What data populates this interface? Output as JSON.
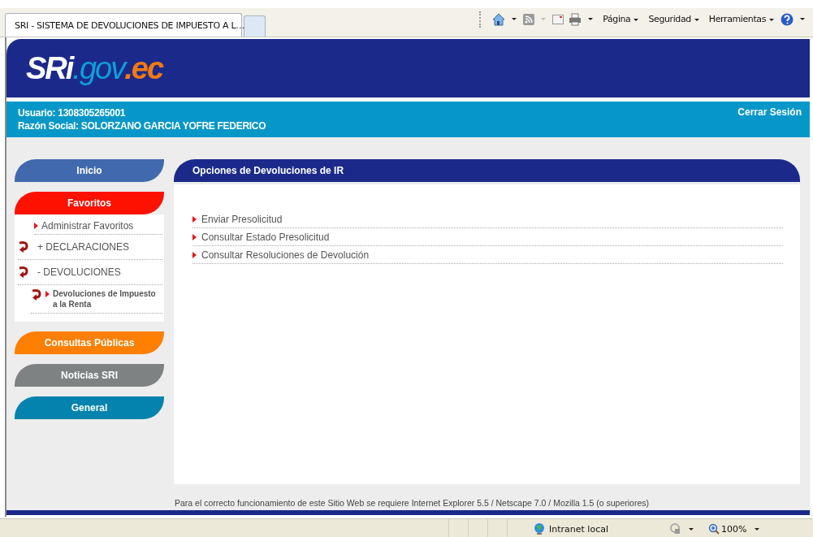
{
  "browser": {
    "tabs": [
      {
        "title": "SRI - SISTEMA DE DEVOLUCIONES DE IMPUESTO A L…",
        "selected": true
      },
      {
        "selected": false
      }
    ],
    "toolbar": [
      "Página",
      "Seguridad",
      "Herramientas"
    ]
  },
  "header": {
    "logo": [
      "SRi",
      ".gov",
      ".ec"
    ]
  },
  "user_bar": {
    "lines": [
      "Usuario: 1308305265001",
      "Razón Social: SOLORZANO GARCIA YOFRE FEDERICO"
    ],
    "logout": "Cerrar Sesión"
  },
  "sidebar": {
    "items": [
      {
        "label": "Inicio",
        "color": "#4169ae"
      },
      {
        "label": "Favoritos",
        "color": "#ff1100",
        "children": [
          {
            "kind": "link",
            "label": "Administrar Favoritos"
          },
          {
            "kind": "folder",
            "label": "+ DECLARACIONES"
          },
          {
            "kind": "folder",
            "label": "- DEVOLUCIONES",
            "children": [
              {
                "kind": "sublink",
                "label": "Devoluciones de Impuesto a la Renta"
              }
            ]
          }
        ]
      },
      {
        "label": "Consultas Públicas",
        "color": "#ff7f00"
      },
      {
        "label": "Noticias SRI",
        "color": "#7f8283"
      },
      {
        "label": "General",
        "color": "#0383ad"
      }
    ]
  },
  "content": {
    "title": "Opciones de Devoluciones de IR",
    "links": [
      "Enviar Presolicitud",
      "Consultar Estado Presolicitud",
      "Consultar Resoluciones de Devolución"
    ]
  },
  "footer": "Para el correcto funcionamiento de este Sitio Web se requiere Internet Explorer 5.5 / Netscape 7.0 / Mozilla 1.5 (o superiores)",
  "status_bar": {
    "zone": "Intranet local",
    "zoom": "100%"
  }
}
